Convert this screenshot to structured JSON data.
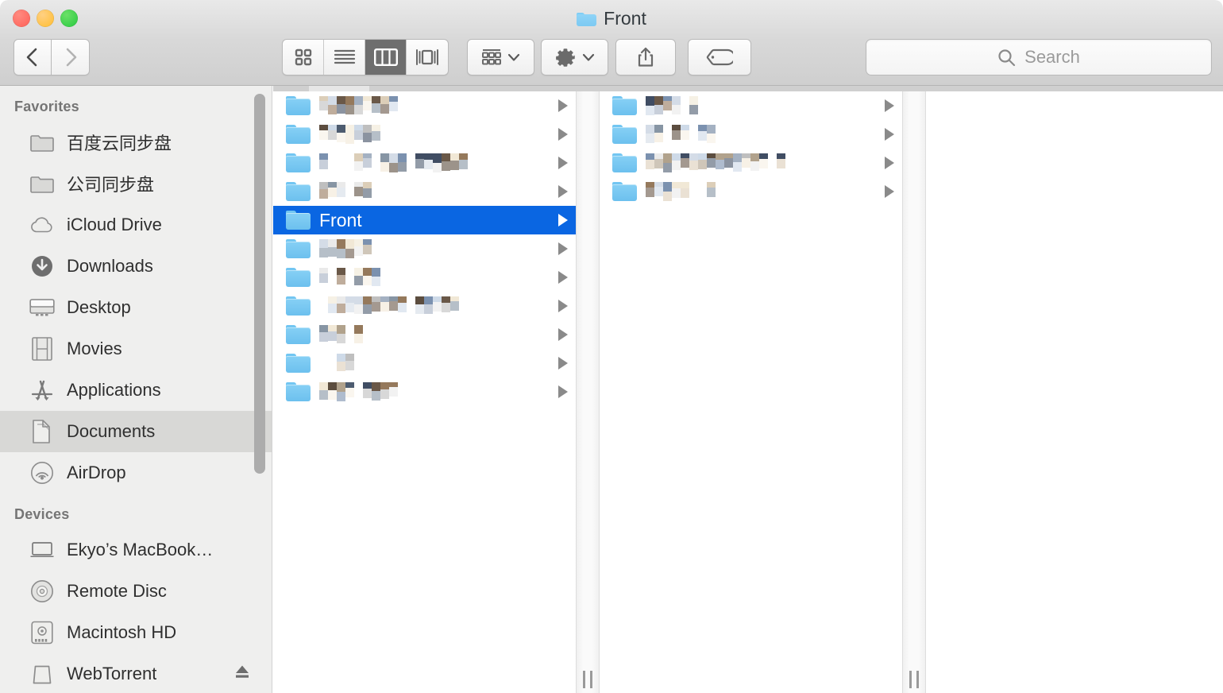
{
  "window": {
    "title": "Front",
    "title_icon": "folder-icon",
    "traffic_lights": [
      {
        "name": "close-button",
        "color": "#ff5f56"
      },
      {
        "name": "minimize-button",
        "color": "#ffbd2e"
      },
      {
        "name": "maximize-button",
        "color": "#27c93f"
      }
    ]
  },
  "toolbar": {
    "back_icon": "chevron-left-icon",
    "forward_icon": "chevron-right-icon",
    "back_enabled": true,
    "forward_enabled": false,
    "view_modes": [
      {
        "label": "Icon View",
        "icon": "grid-icon",
        "active": false
      },
      {
        "label": "List View",
        "icon": "list-icon",
        "active": false
      },
      {
        "label": "Column View",
        "icon": "columns-icon",
        "active": true
      },
      {
        "label": "Gallery View",
        "icon": "gallery-icon",
        "active": false
      }
    ],
    "arrange": {
      "label": "Arrange",
      "icon": "arrange-icon",
      "chevron": "chevron-down-icon"
    },
    "action": {
      "label": "Action",
      "icon": "gear-icon",
      "chevron": "chevron-down-icon"
    },
    "share": {
      "label": "Share",
      "icon": "share-icon"
    },
    "tags": {
      "label": "Tags",
      "icon": "tag-icon"
    }
  },
  "search": {
    "placeholder": "Search",
    "value": "",
    "icon": "search-icon"
  },
  "sidebar": {
    "sections": [
      {
        "header": "Favorites",
        "items": [
          {
            "label": "百度云同步盘",
            "icon": "folder-icon",
            "selected": false
          },
          {
            "label": "公司同步盘",
            "icon": "folder-icon",
            "selected": false
          },
          {
            "label": "iCloud Drive",
            "icon": "cloud-icon",
            "selected": false
          },
          {
            "label": "Downloads",
            "icon": "download-icon",
            "selected": false
          },
          {
            "label": "Desktop",
            "icon": "desktop-icon",
            "selected": false
          },
          {
            "label": "Movies",
            "icon": "film-icon",
            "selected": false
          },
          {
            "label": "Applications",
            "icon": "applications-icon",
            "selected": false
          },
          {
            "label": "Documents",
            "icon": "documents-icon",
            "selected": true
          },
          {
            "label": "AirDrop",
            "icon": "airdrop-icon",
            "selected": false
          }
        ]
      },
      {
        "header": "Devices",
        "items": [
          {
            "label": "Ekyo’s MacBook…",
            "icon": "laptop-icon",
            "selected": false,
            "eject": false
          },
          {
            "label": "Remote Disc",
            "icon": "disc-icon",
            "selected": false,
            "eject": false
          },
          {
            "label": "Macintosh HD",
            "icon": "harddrive-icon",
            "selected": false,
            "eject": false
          },
          {
            "label": "WebTorrent",
            "icon": "volume-icon",
            "selected": false,
            "eject": true
          }
        ]
      }
    ]
  },
  "browser": {
    "columns": [
      {
        "name": "column-1",
        "rows": [
          {
            "label": "",
            "redacted": true,
            "redacted_width": 98,
            "selected": false,
            "has_children": true
          },
          {
            "label": "",
            "redacted": true,
            "redacted_width": 80,
            "selected": false,
            "has_children": true
          },
          {
            "label": "",
            "redacted": true,
            "redacted_width": 188,
            "selected": false,
            "has_children": true
          },
          {
            "label": "",
            "redacted": true,
            "redacted_width": 78,
            "selected": false,
            "has_children": true
          },
          {
            "label": "Front",
            "redacted": false,
            "redacted_width": 0,
            "selected": true,
            "has_children": true
          },
          {
            "label": "",
            "redacted": true,
            "redacted_width": 84,
            "selected": false,
            "has_children": true
          },
          {
            "label": "",
            "redacted": true,
            "redacted_width": 92,
            "selected": false,
            "has_children": true
          },
          {
            "label": "",
            "redacted": true,
            "redacted_width": 172,
            "selected": false,
            "has_children": true
          },
          {
            "label": "",
            "redacted": true,
            "redacted_width": 60,
            "selected": false,
            "has_children": true
          },
          {
            "label": "",
            "redacted": true,
            "redacted_width": 48,
            "selected": false,
            "has_children": true
          },
          {
            "label": "",
            "redacted": true,
            "redacted_width": 100,
            "selected": false,
            "has_children": true
          }
        ]
      },
      {
        "name": "column-2",
        "rows": [
          {
            "label": "",
            "redacted": true,
            "redacted_width": 80,
            "selected": false,
            "has_children": true
          },
          {
            "label": "",
            "redacted": true,
            "redacted_width": 92,
            "selected": false,
            "has_children": true
          },
          {
            "label": "",
            "redacted": true,
            "redacted_width": 186,
            "selected": false,
            "has_children": true
          },
          {
            "label": "",
            "redacted": true,
            "redacted_width": 84,
            "selected": false,
            "has_children": true
          }
        ]
      },
      {
        "name": "column-3",
        "rows": []
      }
    ],
    "selected_item": "Front",
    "selection_color": "#0a66e2",
    "resize_grips": 2
  }
}
